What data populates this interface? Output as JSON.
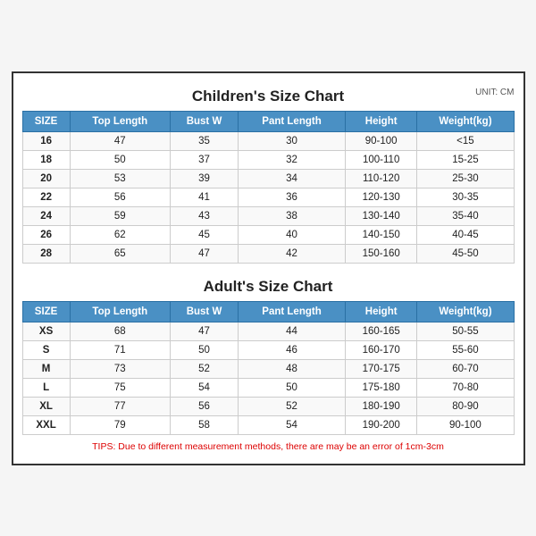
{
  "children_title": "Children's Size Chart",
  "adult_title": "Adult's Size Chart",
  "unit_label": "UNIT: CM",
  "tips": "TIPS: Due to different measurement methods, there are may be an error of 1cm-3cm",
  "columns": [
    "SIZE",
    "Top Length",
    "Bust W",
    "Pant Length",
    "Height",
    "Weight(kg)"
  ],
  "children_rows": [
    [
      "16",
      "47",
      "35",
      "30",
      "90-100",
      "<15"
    ],
    [
      "18",
      "50",
      "37",
      "32",
      "100-110",
      "15-25"
    ],
    [
      "20",
      "53",
      "39",
      "34",
      "110-120",
      "25-30"
    ],
    [
      "22",
      "56",
      "41",
      "36",
      "120-130",
      "30-35"
    ],
    [
      "24",
      "59",
      "43",
      "38",
      "130-140",
      "35-40"
    ],
    [
      "26",
      "62",
      "45",
      "40",
      "140-150",
      "40-45"
    ],
    [
      "28",
      "65",
      "47",
      "42",
      "150-160",
      "45-50"
    ]
  ],
  "adult_rows": [
    [
      "XS",
      "68",
      "47",
      "44",
      "160-165",
      "50-55"
    ],
    [
      "S",
      "71",
      "50",
      "46",
      "160-170",
      "55-60"
    ],
    [
      "M",
      "73",
      "52",
      "48",
      "170-175",
      "60-70"
    ],
    [
      "L",
      "75",
      "54",
      "50",
      "175-180",
      "70-80"
    ],
    [
      "XL",
      "77",
      "56",
      "52",
      "180-190",
      "80-90"
    ],
    [
      "XXL",
      "79",
      "58",
      "54",
      "190-200",
      "90-100"
    ]
  ]
}
